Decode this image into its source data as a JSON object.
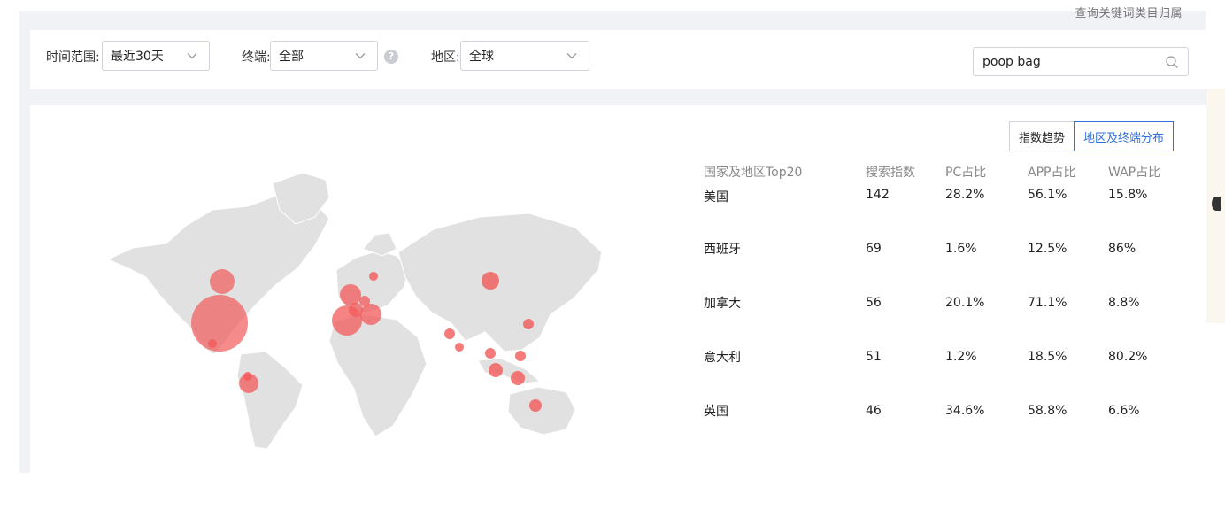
{
  "top_hint": "查询关键词类目归属",
  "filters": {
    "time_label": "时间范围:",
    "time_value": "最近30天",
    "terminal_label": "终端:",
    "terminal_value": "全部",
    "help": "?",
    "region_label": "地区:",
    "region_value": "全球"
  },
  "search": {
    "value": "poop bag",
    "placeholder": ""
  },
  "tabs": [
    {
      "label": "指数趋势",
      "active": false
    },
    {
      "label": "地区及终端分布",
      "active": true
    }
  ],
  "table": {
    "headers": [
      "国家及地区Top20",
      "搜索指数",
      "PC占比",
      "APP占比",
      "WAP占比"
    ],
    "rows": [
      [
        "美国",
        "142",
        "28.2%",
        "56.1%",
        "15.8%"
      ],
      [
        "西班牙",
        "69",
        "1.6%",
        "12.5%",
        "86%"
      ],
      [
        "加拿大",
        "56",
        "20.1%",
        "71.1%",
        "8.8%"
      ],
      [
        "意大利",
        "51",
        "1.2%",
        "18.5%",
        "80.2%"
      ],
      [
        "英国",
        "46",
        "34.6%",
        "58.8%",
        "6.6%"
      ]
    ]
  },
  "colors": {
    "accent": "#2f6fe0",
    "bubble": "#f25a5a",
    "land": "#e1e1e1"
  }
}
